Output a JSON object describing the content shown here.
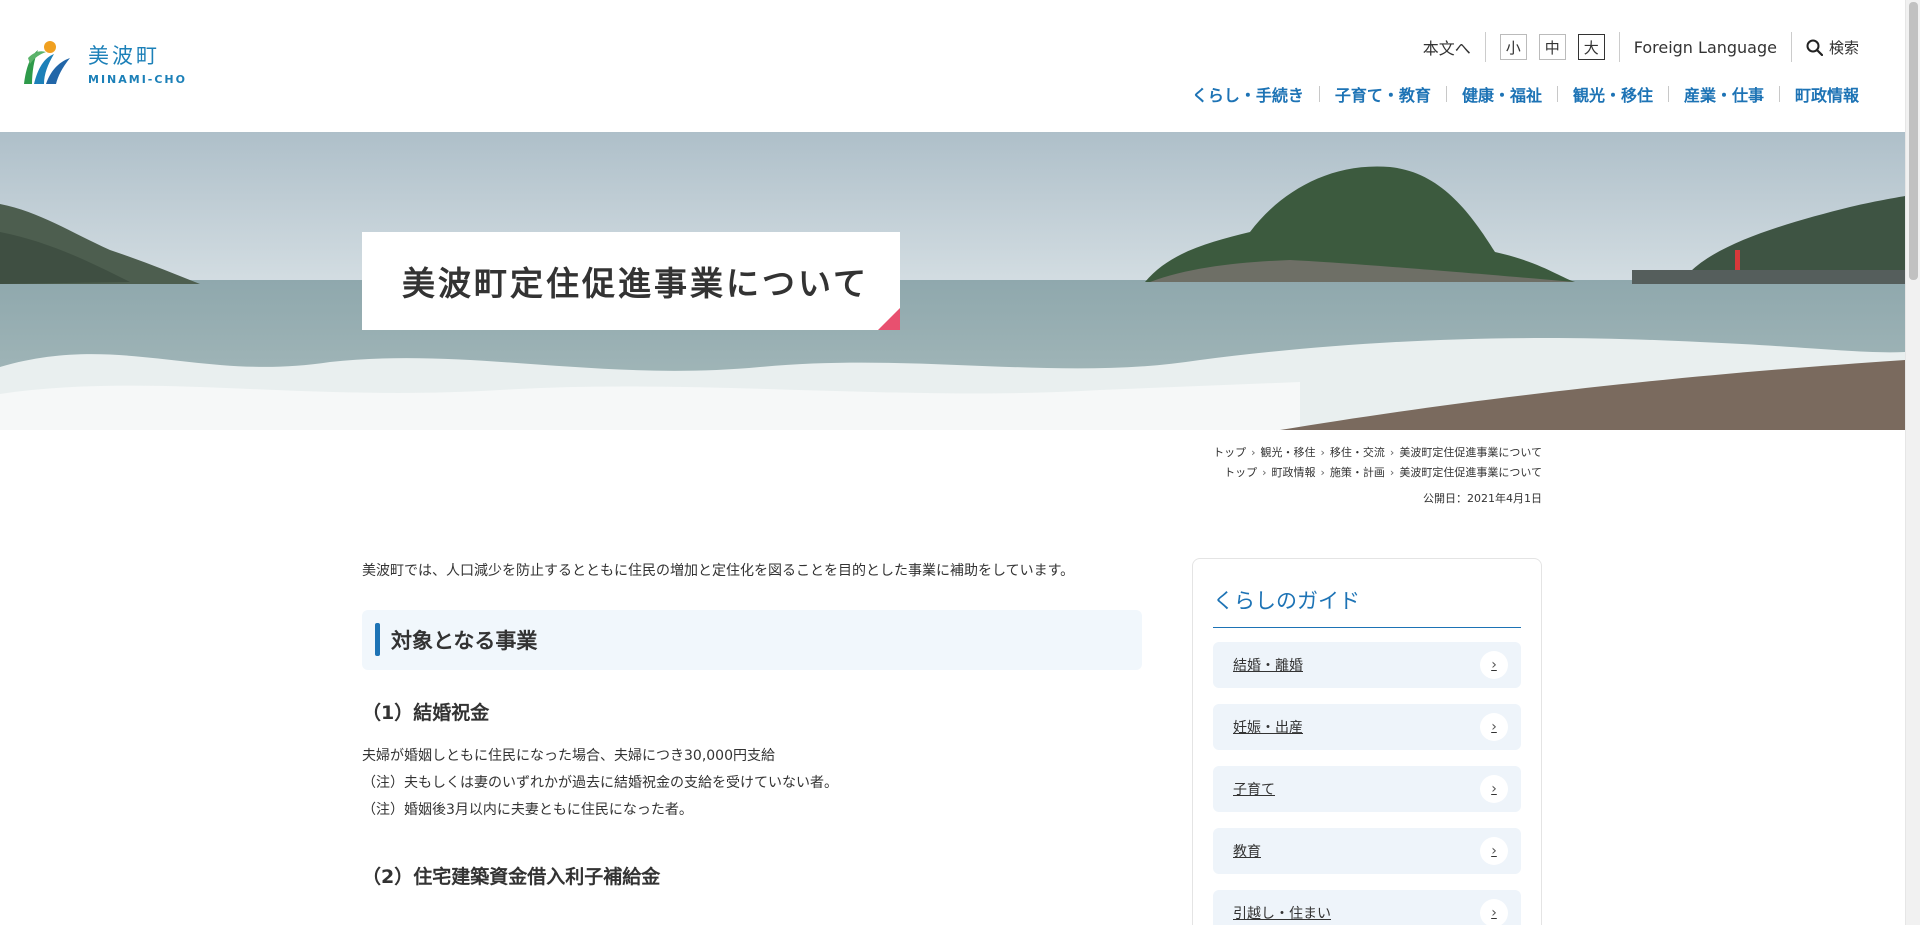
{
  "site": {
    "logo_jp": "美波町",
    "logo_en": "MINAMI-CHO"
  },
  "utility": {
    "skip_label": "本文へ",
    "font_sizes": [
      "小",
      "中",
      "大"
    ],
    "foreign_language": "Foreign Language",
    "search_label": "検索"
  },
  "global_nav": [
    "くらし・手続き",
    "子育て・教育",
    "健康・福祉",
    "観光・移住",
    "産業・仕事",
    "町政情報"
  ],
  "hero": {
    "title": "美波町定住促進事業について"
  },
  "breadcrumbs": [
    [
      "トップ",
      "観光・移住",
      "移住・交流",
      "美波町定住促進事業について"
    ],
    [
      "トップ",
      "町政情報",
      "施策・計画",
      "美波町定住促進事業について"
    ]
  ],
  "published": "公開日：2021年4月1日",
  "content": {
    "lead": "美波町では、人口減少を防止するとともに住民の増加と定住化を図ることを目的とした事業に補助をしています。",
    "section_title": "対象となる事業",
    "sub1_title": "（1）結婚祝金",
    "sub1_lines": [
      "夫婦が婚姻しともに住民になった場合、夫婦につき30,000円支給",
      "（注）夫もしくは妻のいずれかが過去に結婚祝金の支給を受けていない者。",
      "（注）婚姻後3月以内に夫妻ともに住民になった者。"
    ],
    "sub2_title": "（2）住宅建築資金借入利子補給金"
  },
  "sidebar": {
    "title": "くらしのガイド",
    "items": [
      "結婚・離婚",
      "妊娠・出産",
      "子育て",
      "教育",
      "引越し・住まい"
    ]
  },
  "colors": {
    "brand_blue": "#1d73b5",
    "accent_pink": "#e8506f",
    "panel_bg": "#eef4fa"
  }
}
